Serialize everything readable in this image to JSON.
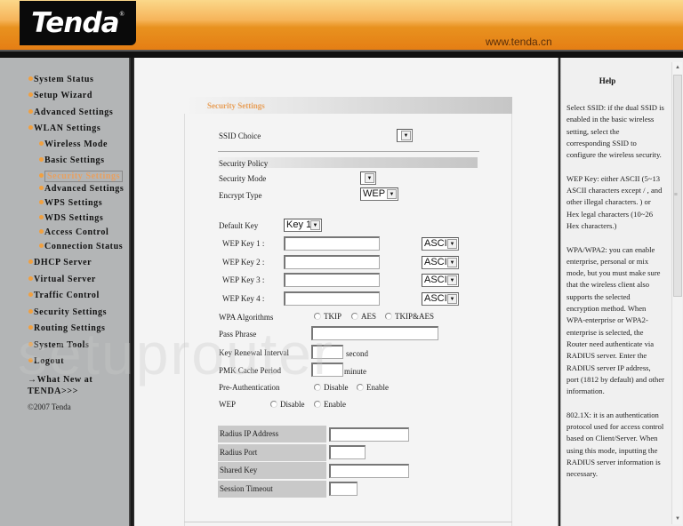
{
  "header": {
    "logo_text": "Tenda",
    "logo_mark": "®",
    "site_url": "www.tenda.cn"
  },
  "sidebar": {
    "items": [
      {
        "label": "System Status",
        "level": 1
      },
      {
        "label": "Setup Wizard",
        "level": 1
      },
      {
        "label": "Advanced Settings",
        "level": 1
      },
      {
        "label": "WLAN Settings",
        "level": 1
      },
      {
        "label": "Wireless Mode",
        "level": 2
      },
      {
        "label": "Basic Settings",
        "level": 2
      },
      {
        "label": "Security Settings",
        "level": 2,
        "selected": true
      },
      {
        "label": "Advanced Settings",
        "level": 2
      },
      {
        "label": "WPS Settings",
        "level": 2
      },
      {
        "label": "WDS Settings",
        "level": 2
      },
      {
        "label": "Access Control",
        "level": 2
      },
      {
        "label": "Connection Status",
        "level": 2
      },
      {
        "label": "DHCP Server",
        "level": 1
      },
      {
        "label": "Virtual Server",
        "level": 1
      },
      {
        "label": "Traffic Control",
        "level": 1
      },
      {
        "label": "Security Settings",
        "level": 1
      },
      {
        "label": "Routing Settings",
        "level": 1
      },
      {
        "label": "System Tools",
        "level": 1
      },
      {
        "label": "Logout",
        "level": 1
      }
    ],
    "whats_new_line1": "→What New at",
    "whats_new_line2": "TENDA>>>",
    "copyright": "©2007 Tenda",
    "accent_color": "#f0a040"
  },
  "form": {
    "title": "Security Settings",
    "ssid_choice_label": "SSID Choice",
    "ssid_choice_value": "",
    "security_policy_label": "Security Policy",
    "security_mode_label": "Security Mode",
    "security_mode_value": "",
    "encrypt_type_label": "Encrypt Type",
    "encrypt_type_value": "WEP",
    "default_key_label": "Default Key",
    "default_key_value": "Key 1",
    "wep_keys": [
      {
        "label": "WEP Key 1 :",
        "value": "",
        "format": "ASCII"
      },
      {
        "label": "WEP Key 2 :",
        "value": "",
        "format": "ASCII"
      },
      {
        "label": "WEP Key 3 :",
        "value": "",
        "format": "ASCII"
      },
      {
        "label": "WEP Key 4 :",
        "value": "",
        "format": "ASCII"
      }
    ],
    "wpa_algorithms_label": "WPA Algorithms",
    "wpa_algorithms_options": [
      "TKIP",
      "AES",
      "TKIP&AES"
    ],
    "pass_phrase_label": "Pass Phrase",
    "pass_phrase_value": "",
    "key_renewal_label": "Key Renewal Interval",
    "key_renewal_value": "",
    "key_renewal_unit": "second",
    "pmk_cache_label": "PMK Cache Period",
    "pmk_cache_value": "",
    "pmk_cache_unit": "minute",
    "preauth_label": "Pre-Authentication",
    "preauth_options": [
      "Disable",
      "Enable"
    ],
    "wep_label": "WEP",
    "wep_options": [
      "Disable",
      "Enable"
    ],
    "radius_ip_label": "Radius IP Address",
    "radius_ip_value": "",
    "radius_port_label": "Radius Port",
    "radius_port_value": "",
    "shared_key_label": "Shared Key",
    "shared_key_value": "",
    "session_timeout_label": "Session Timeout",
    "session_timeout_value": "",
    "title_color": "#e8a05a"
  },
  "help": {
    "title": "Help",
    "paragraphs": [
      "Select SSID: if the dual SSID is enabled in the basic wireless setting, select the corresponding SSID to configure the wireless security.",
      "WEP Key: either ASCII (5~13 ASCII characters except / , and other illegal characters. ) or Hex legal characters (10~26 Hex characters.)",
      "WPA/WPA2: you can enable enterprise, personal or mix mode, but you must make sure that the wireless client also supports the selected encryption method. When WPA-enterprise or WPA2-enterprise is selected, the Router need authenticate via RADIUS server. Enter the RADIUS server IP address, port (1812 by default) and other information.",
      "802.1X: it is an authentication protocol used for access control based on Client/Server. When using this mode, inputting the RADIUS server information is necessary."
    ]
  },
  "watermark": "setuprouter"
}
